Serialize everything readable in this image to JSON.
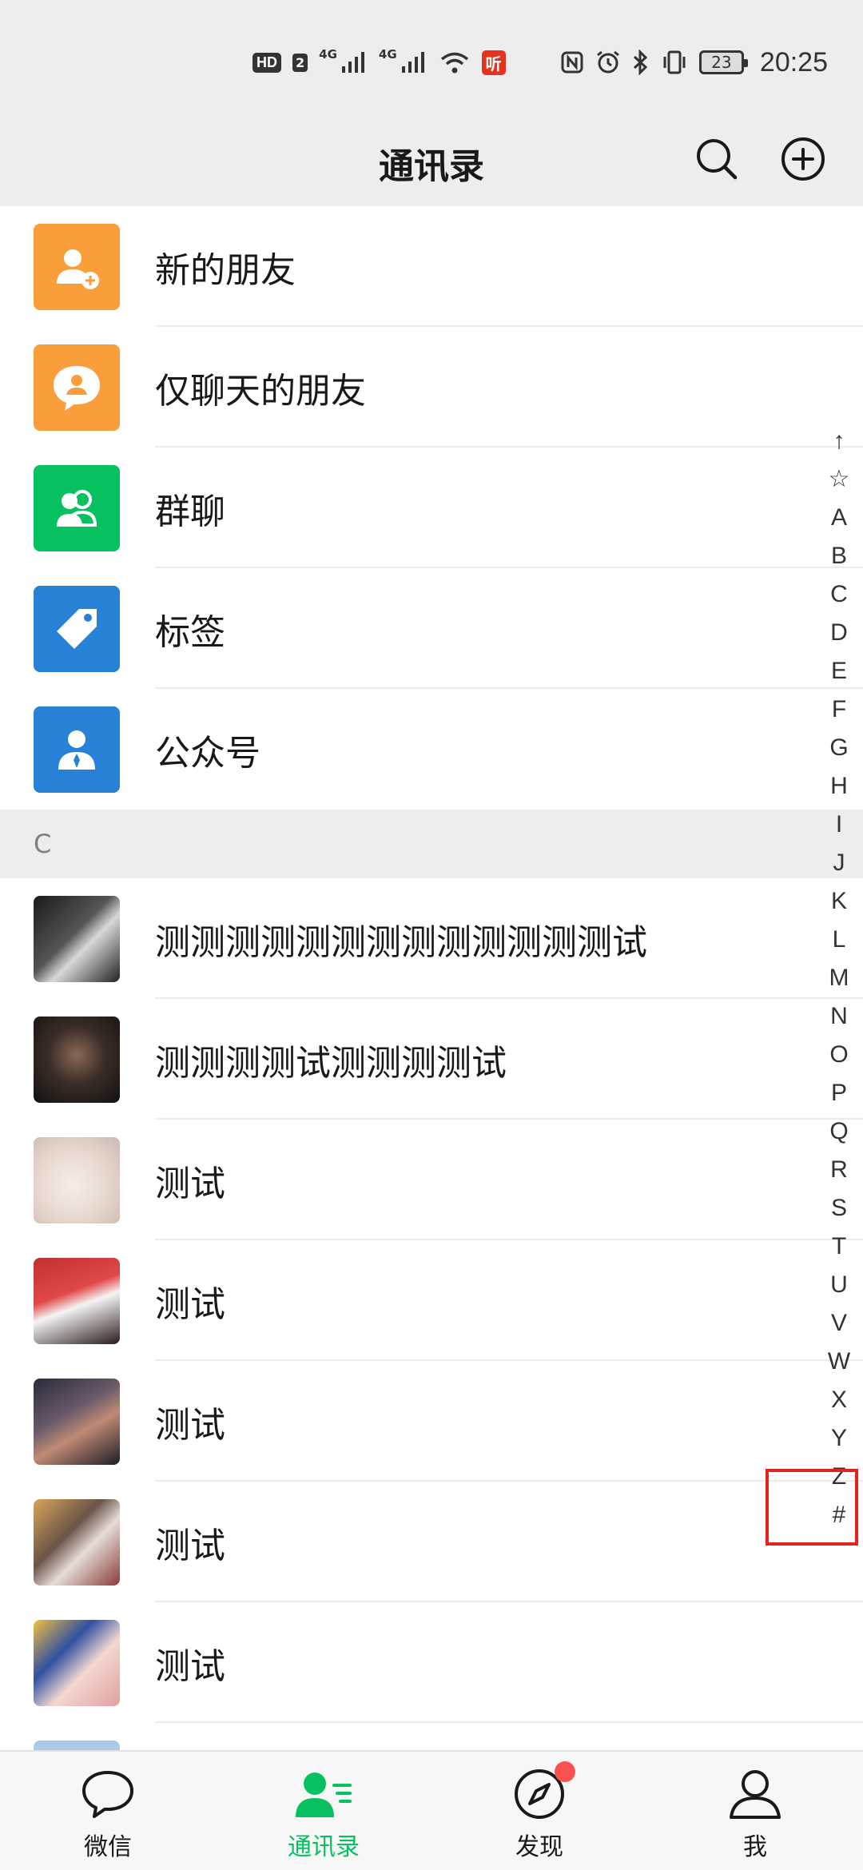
{
  "status_bar": {
    "hd": "HD",
    "sim": "2",
    "net1": "4G",
    "net2": "4G",
    "listen": "听",
    "battery": "23",
    "time": "20:25"
  },
  "header": {
    "title": "通讯录",
    "search_icon": "search-icon",
    "add_icon": "add-circle-icon"
  },
  "functions": [
    {
      "label": "新的朋友",
      "icon": "add-friend-icon",
      "color": "#fa9d3b"
    },
    {
      "label": "仅聊天的朋友",
      "icon": "chat-only-friend-icon",
      "color": "#fa9d3b"
    },
    {
      "label": "群聊",
      "icon": "group-chat-icon",
      "color": "#07c160"
    },
    {
      "label": "标签",
      "icon": "tag-icon",
      "color": "#2782d7"
    },
    {
      "label": "公众号",
      "icon": "official-account-icon",
      "color": "#2782d7"
    }
  ],
  "section": {
    "letter": "C"
  },
  "contacts": [
    {
      "name": "测测测测测测测测测测测测测试"
    },
    {
      "name": "测测测测试测测测测试"
    },
    {
      "name": "测试"
    },
    {
      "name": "测试"
    },
    {
      "name": "测试"
    },
    {
      "name": "测试"
    },
    {
      "name": "测试"
    }
  ],
  "index_bar": [
    "↑",
    "☆",
    "A",
    "B",
    "C",
    "D",
    "E",
    "F",
    "G",
    "H",
    "I",
    "J",
    "K",
    "L",
    "M",
    "N",
    "O",
    "P",
    "Q",
    "R",
    "S",
    "T",
    "U",
    "V",
    "W",
    "X",
    "Y",
    "Z",
    "#"
  ],
  "tabs": [
    {
      "label": "微信",
      "icon": "chat-bubble-icon"
    },
    {
      "label": "通讯录",
      "icon": "contacts-icon",
      "active": true
    },
    {
      "label": "发现",
      "icon": "compass-icon",
      "badge": "red-dot"
    },
    {
      "label": "我",
      "icon": "person-icon"
    }
  ],
  "colors": {
    "accent": "#07c160",
    "orange": "#fa9d3b",
    "blue": "#2782d7",
    "highlight": "#e52222",
    "badge": "#fa5151"
  }
}
